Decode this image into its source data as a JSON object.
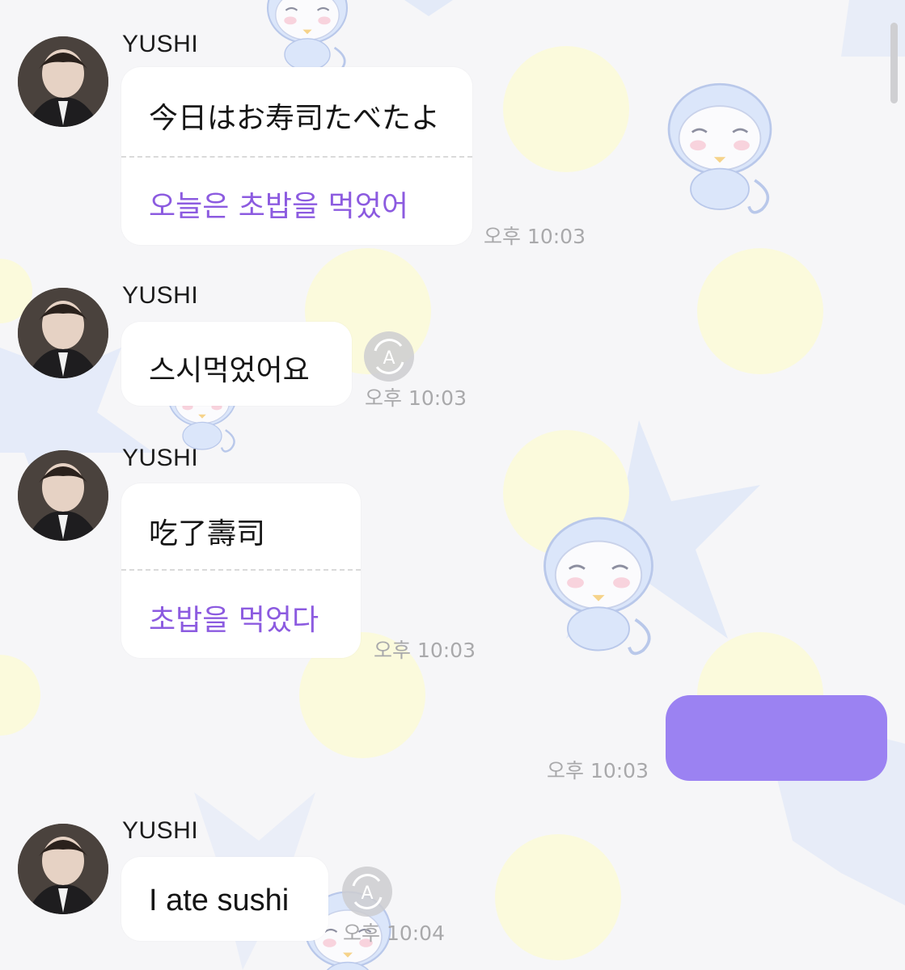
{
  "messages": [
    {
      "sender": "YUSHI",
      "text": "今日はお寿司たべたよ",
      "translation": "오늘은 초밥을 먹었어",
      "time": "오후 10:03"
    },
    {
      "sender": "YUSHI",
      "text": "스시먹었어요",
      "translate_icon": "auto-translate-icon",
      "time": "오후 10:03"
    },
    {
      "sender": "YUSHI",
      "text": "吃了壽司",
      "translation": "초밥을 먹었다",
      "time": "오후 10:03"
    },
    {
      "sender": "me",
      "text": "",
      "time": "오후 10:03"
    },
    {
      "sender": "YUSHI",
      "text": "I ate sushi",
      "translate_icon": "auto-translate-icon",
      "time": "오후 10:04"
    }
  ],
  "colors": {
    "translation_text": "#8c5be0",
    "sent_bubble": "#9b82f2",
    "background": "#f6f6f8"
  }
}
